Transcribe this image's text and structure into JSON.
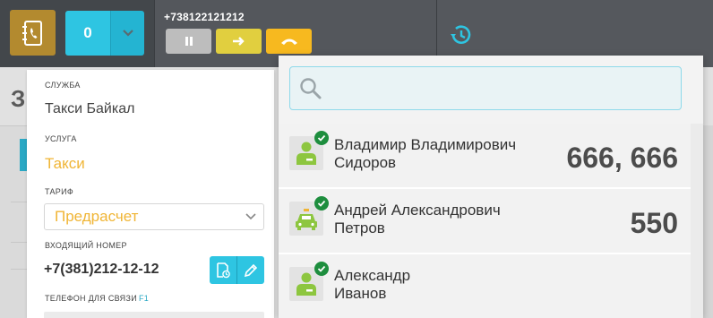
{
  "topbar": {
    "counter_value": "0",
    "phone_number": "+738122121212"
  },
  "icons": {
    "contacts": "address-book-icon",
    "dropdown": "chevron-down-icon",
    "pause": "pause-icon",
    "transfer": "arrow-right-icon",
    "hangup": "hang-up-icon",
    "history": "history-icon",
    "search": "search-icon",
    "call_log": "call-log-icon",
    "edit": "pencil-icon",
    "person": "person-icon",
    "taxi": "taxi-icon",
    "check": "check-icon"
  },
  "colors": {
    "accent_cyan": "#2ec5e2",
    "accent_yellow": "#f0b535",
    "contacts_gold": "#b38a2f",
    "transfer_yellow": "#e1cf3f",
    "hangup_orange": "#f7b91f",
    "online_green": "#1e8e3e",
    "avatar_green": "#8dc63f"
  },
  "background": {
    "heading_fragment": "З"
  },
  "form": {
    "service_label": "Служба",
    "service_value": "Такси Байкал",
    "product_label": "Услуга",
    "product_value": "Такси",
    "tariff_label": "Тариф",
    "tariff_value": "Предрасчет",
    "incoming_label": "Входящий номер",
    "incoming_value": "+7(381)212-12-12",
    "contact_phone_label": "Телефон для связи",
    "contact_phone_hint": "F1"
  },
  "search": {
    "placeholder": "",
    "results": [
      {
        "name_line1": "Владимир Владимирович",
        "name_line2": "Сидоров",
        "amount": "666, 666",
        "avatar_type": "person",
        "online": true
      },
      {
        "name_line1": "Андрей Александрович",
        "name_line2": "Петров",
        "amount": "550",
        "avatar_type": "taxi",
        "online": true
      },
      {
        "name_line1": "Александр",
        "name_line2": "Иванов",
        "amount": "",
        "avatar_type": "person",
        "online": true
      }
    ]
  }
}
